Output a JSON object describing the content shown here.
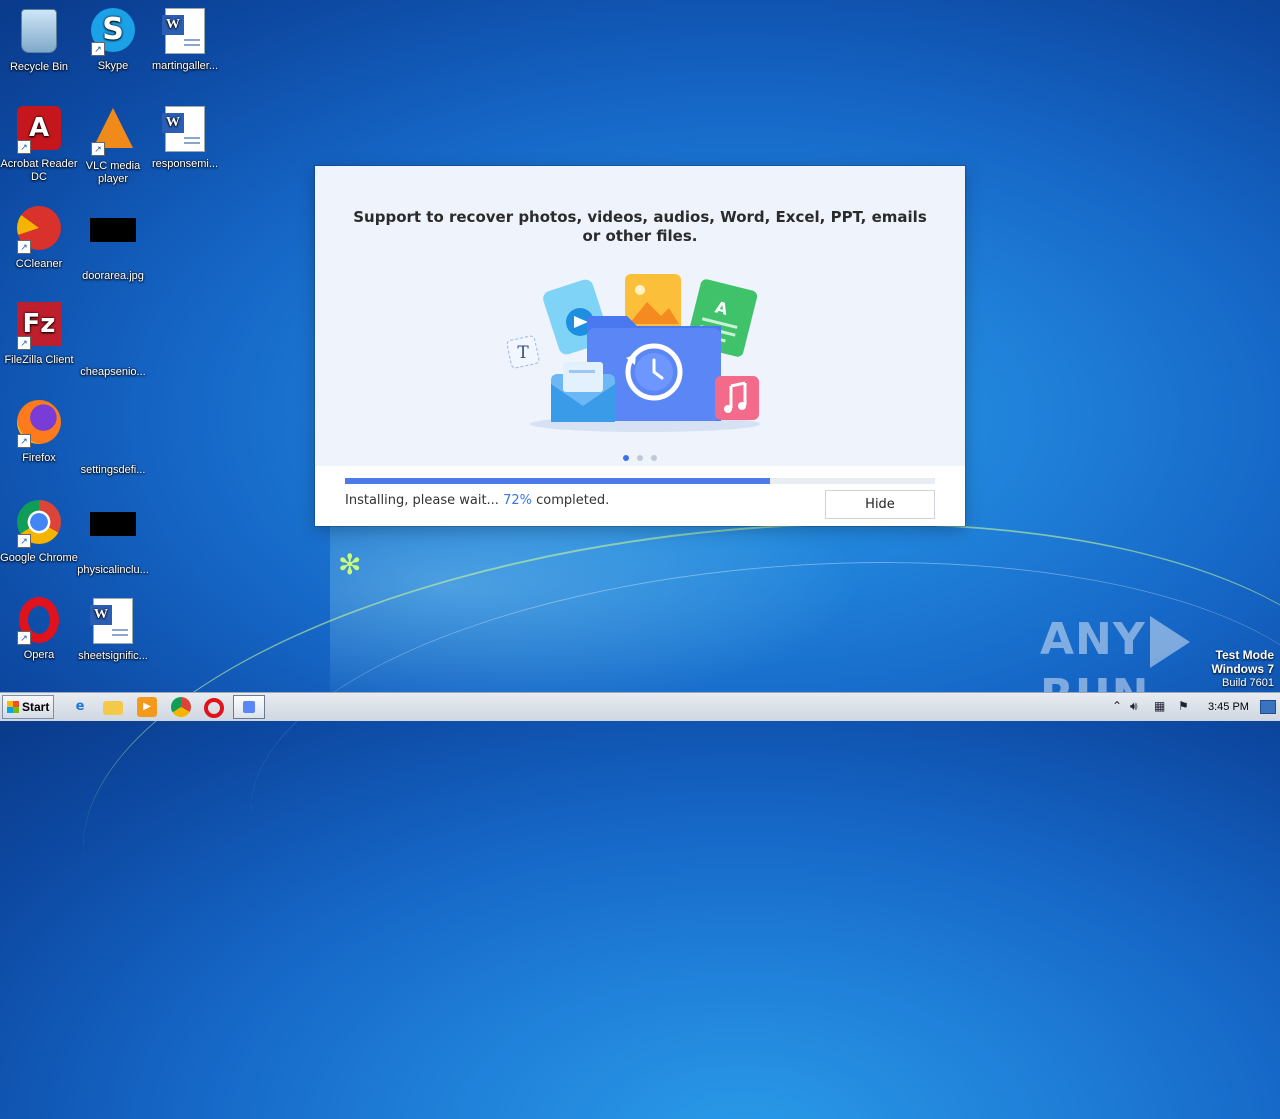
{
  "desktop": {
    "icons": [
      {
        "label": "Recycle Bin"
      },
      {
        "label": "Skype"
      },
      {
        "label": "martingaller..."
      },
      {
        "label": "Acrobat Reader DC"
      },
      {
        "label": "VLC media player"
      },
      {
        "label": "responsemi..."
      },
      {
        "label": "CCleaner"
      },
      {
        "label": "doorarea.jpg"
      },
      {
        "label": "FileZilla Client"
      },
      {
        "label": "cheapsenio..."
      },
      {
        "label": "Firefox"
      },
      {
        "label": "settingsdefi..."
      },
      {
        "label": "Google Chrome"
      },
      {
        "label": "physicalinclu..."
      },
      {
        "label": "Opera"
      },
      {
        "label": "sheetsignific..."
      }
    ]
  },
  "installer": {
    "headline": "Support to recover photos, videos, audios, Word, Excel, PPT, emails or other files.",
    "illustration_icons": [
      "text-icon",
      "video-icon",
      "image-icon",
      "document-icon",
      "email-icon",
      "restore-folder-icon",
      "music-icon"
    ],
    "slide_count": 3,
    "active_slide": 1,
    "progress_percent": 72,
    "status_prefix": "Installing, please wait...",
    "status_percent": "72%",
    "status_suffix": "completed.",
    "hide_label": "Hide",
    "accent_color": "#3b74e8"
  },
  "watermark": {
    "text_left": "ANY",
    "text_right": "RUN"
  },
  "system": {
    "test_mode": "Test Mode",
    "os_name": "Windows 7",
    "build": "Build 7601"
  },
  "taskbar": {
    "start_label": "Start",
    "pinned": [
      "internet-explorer-icon",
      "explorer-icon",
      "media-player-icon",
      "chrome-icon",
      "opera-icon",
      "installer-icon"
    ],
    "clock": "3:45 PM"
  }
}
